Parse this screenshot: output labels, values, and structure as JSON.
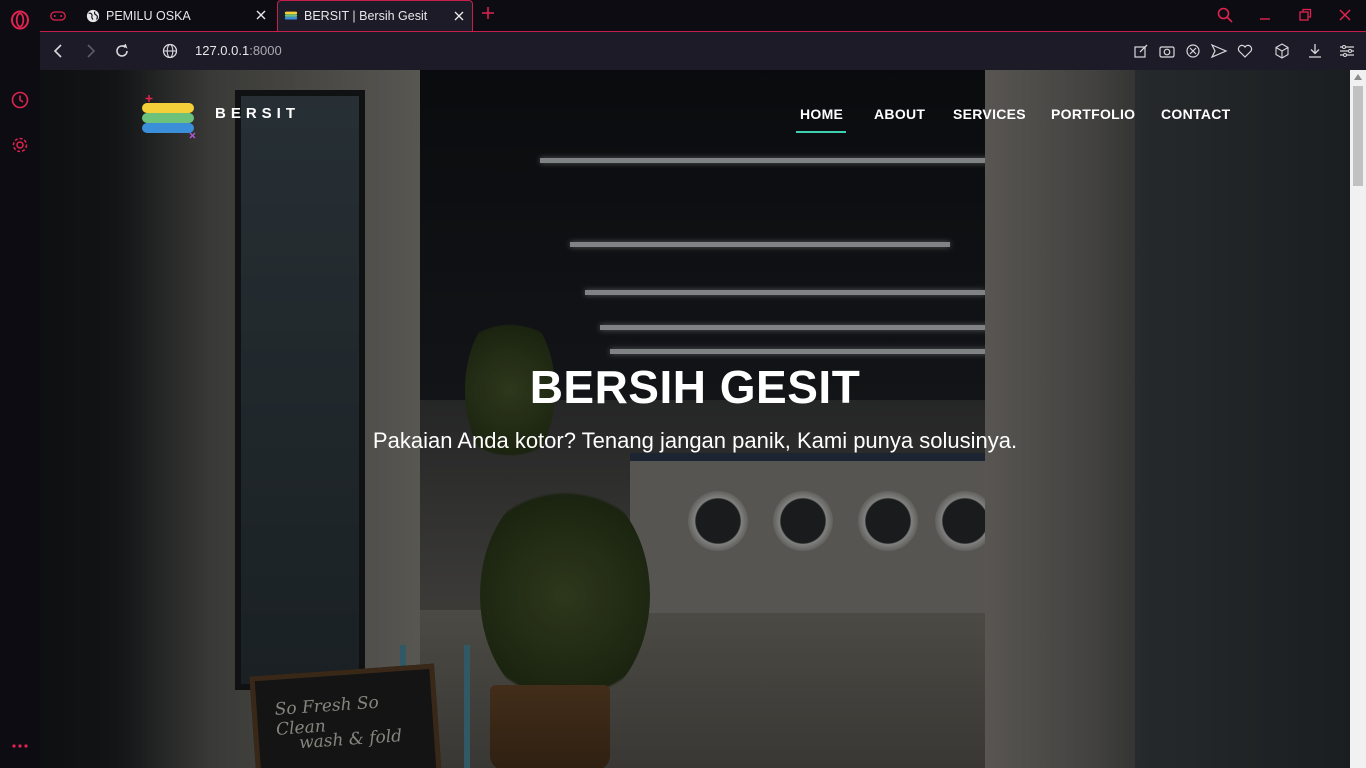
{
  "browser": {
    "tabs": [
      {
        "title": "PEMILU OSKA",
        "active": false,
        "icon": "globe-icon"
      },
      {
        "title": "BERSIT | Bersih Gesit",
        "active": true,
        "icon": "site-logo-favicon"
      }
    ],
    "url_host": "127.0.0.1",
    "url_port": ":8000",
    "accent": "#c61f4b"
  },
  "site": {
    "brand": "BERSIT",
    "nav": [
      "HOME",
      "ABOUT",
      "SERVICES",
      "PORTFOLIO",
      "CONTACT"
    ],
    "active_nav": "HOME",
    "accent": "#3fd0b2",
    "hero_title": "BERSIH GESIT",
    "hero_subtitle": "Pakaian Anda kotor? Tenang jangan panik, Kami punya solusinya."
  }
}
